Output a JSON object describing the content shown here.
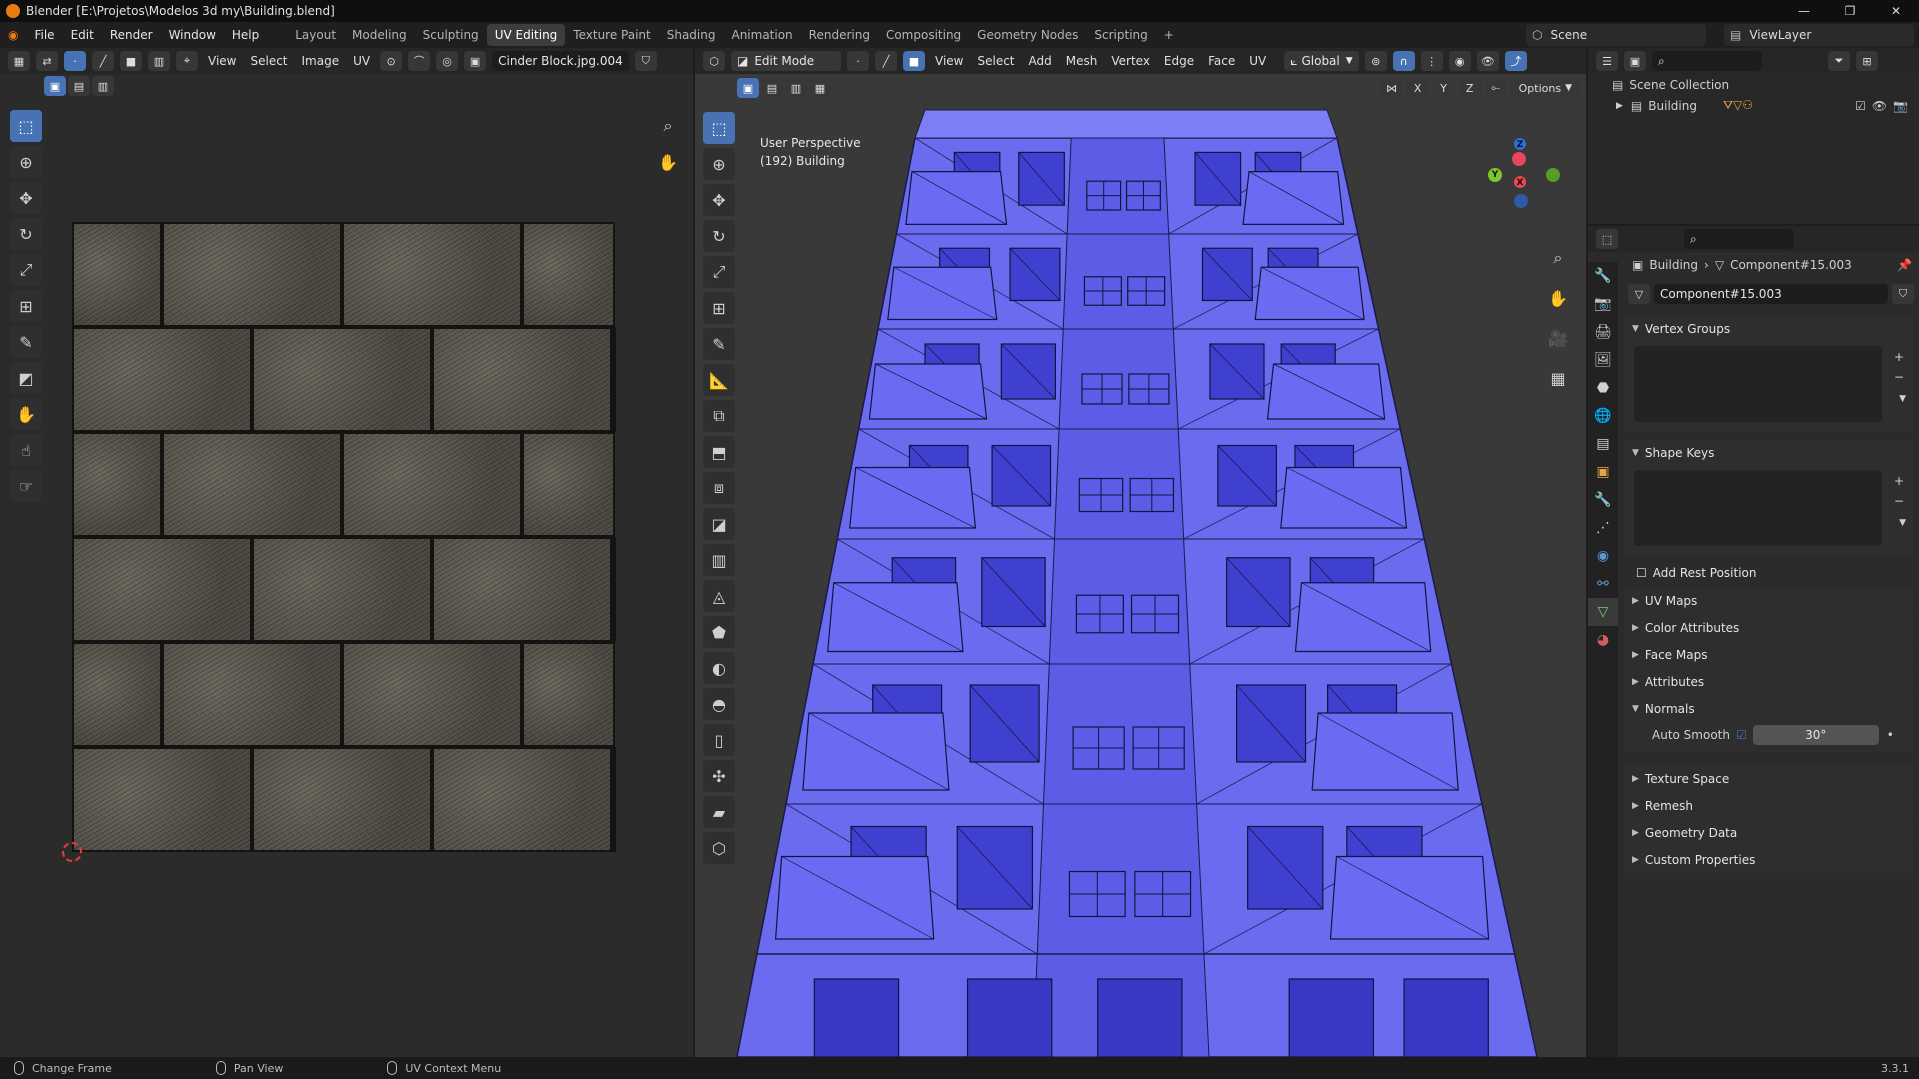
{
  "window": {
    "title": "Blender [E:\\Projetos\\Modelos 3d my\\Building.blend]",
    "controls": [
      "—",
      "❐",
      "✕"
    ]
  },
  "menu": [
    "File",
    "Edit",
    "Render",
    "Window",
    "Help"
  ],
  "workspaces": [
    "Layout",
    "Modeling",
    "Sculpting",
    "UV Editing",
    "Texture Paint",
    "Shading",
    "Animation",
    "Rendering",
    "Compositing",
    "Geometry Nodes",
    "Scripting",
    "+"
  ],
  "active_workspace": "UV Editing",
  "scene": "Scene",
  "view_layer": "ViewLayer",
  "uv_editor": {
    "menus": [
      "View",
      "Select",
      "Image",
      "UV"
    ],
    "image_name": "Cinder Block.jpg.004"
  },
  "viewport": {
    "mode": "Edit Mode",
    "menus": [
      "View",
      "Select",
      "Add",
      "Mesh",
      "Vertex",
      "Edge",
      "Face",
      "UV"
    ],
    "transform_orientation": "Global",
    "axes": [
      "X",
      "Y",
      "Z"
    ],
    "options_label": "Options",
    "overlay_line1": "User Perspective",
    "overlay_line2": "(192) Building",
    "gizmo": {
      "x": "X",
      "y": "Y",
      "z": "Z"
    }
  },
  "outliner": {
    "collection": "Scene Collection",
    "object": "Building"
  },
  "properties": {
    "breadcrumb_object": "Building",
    "breadcrumb_mesh": "Component#15.003",
    "mesh_name": "Component#15.003",
    "sections": {
      "vertex_groups": "Vertex Groups",
      "shape_keys": "Shape Keys",
      "add_rest_position": "Add Rest Position",
      "uv_maps": "UV Maps",
      "color_attributes": "Color Attributes",
      "face_maps": "Face Maps",
      "attributes": "Attributes",
      "normals": "Normals",
      "auto_smooth": "Auto Smooth",
      "auto_smooth_angle": "30°",
      "texture_space": "Texture Space",
      "remesh": "Remesh",
      "geometry_data": "Geometry Data",
      "custom_properties": "Custom Properties"
    }
  },
  "status": {
    "left": "Change Frame",
    "middle": "Pan View",
    "right": "UV Context Menu",
    "version": "3.3.1"
  },
  "colors": {
    "accent": "#4772b3",
    "mesh": "#6b6bf0",
    "blender_orange": "#e87d0d"
  }
}
